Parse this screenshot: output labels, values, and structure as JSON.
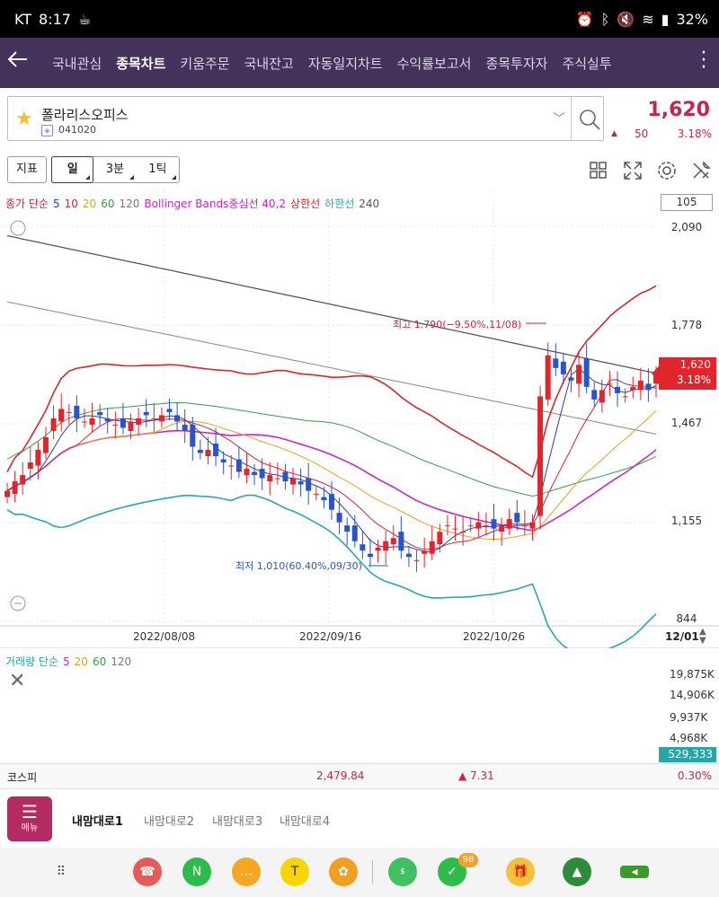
{
  "status": {
    "carrier": "KT",
    "time": "8:17",
    "battery": "32%"
  },
  "nav": {
    "tabs": [
      {
        "label": "국내관심",
        "active": false,
        "dot": false
      },
      {
        "label": "종목차트",
        "active": true,
        "dot": true
      },
      {
        "label": "키움주문",
        "active": false,
        "dot": true
      },
      {
        "label": "국내잔고",
        "active": false,
        "dot": true
      },
      {
        "label": "자동일지차트",
        "active": false,
        "dot": false
      },
      {
        "label": "수익률보고서",
        "active": false,
        "dot": false
      },
      {
        "label": "종목투자자",
        "active": false,
        "dot": false
      },
      {
        "label": "주식실투",
        "active": false,
        "dot": false
      }
    ]
  },
  "stock": {
    "name": "폴라리스오피스",
    "code": "041020",
    "price": "1,620",
    "change_arrow": "▲",
    "change": "50",
    "change_pct": "3.18%"
  },
  "toolbar": {
    "indicator_label": "지표",
    "periods": [
      {
        "label": "일",
        "active": true
      },
      {
        "label": "3분",
        "active": false
      },
      {
        "label": "1틱",
        "active": false
      }
    ]
  },
  "legend": {
    "items": [
      {
        "text": "종가 단순",
        "color": "#c8234a"
      },
      {
        "text": "5",
        "color": "#2d3ea6"
      },
      {
        "text": "10",
        "color": "#c8234a"
      },
      {
        "text": "20",
        "color": "#e0a420"
      },
      {
        "text": "60",
        "color": "#3a9a4a"
      },
      {
        "text": "120",
        "color": "#777777"
      },
      {
        "text": "Bollinger Bands중심선 40,2",
        "color": "#c42ac4"
      },
      {
        "text": "상한선",
        "color": "#d22a2a"
      },
      {
        "text": "하한선",
        "color": "#2aa5b5"
      },
      {
        "text": "240",
        "color": "#555555"
      }
    ]
  },
  "chart": {
    "y_box": "105",
    "y_labels": [
      "2,090",
      "1,778",
      "1,467",
      "1,155",
      "844"
    ],
    "price_tag": "1,620",
    "price_tag_pct": "3.18%",
    "high_annotation": "최고 1,790(−9.50%,11/08)",
    "low_annotation": "최저 1,010(60.40%,09/30)",
    "x_labels": [
      "2022/08/08",
      "2022/09/16",
      "2022/10/26"
    ],
    "last_date": "12/01"
  },
  "volume": {
    "legend": [
      {
        "text": "거래량 단순",
        "color": "#2aa5a5"
      },
      {
        "text": "5",
        "color": "#c42ac4"
      },
      {
        "text": "20",
        "color": "#e0a420"
      },
      {
        "text": "60",
        "color": "#3a9a4a"
      },
      {
        "text": "120",
        "color": "#777777"
      }
    ],
    "y_labels": [
      "19,875K",
      "14,906K",
      "9,937K",
      "4,968K"
    ],
    "tag": "529,333"
  },
  "chart_data": {
    "type": "candlestick",
    "x_labels": [
      "2022/08/08",
      "2022/09/16",
      "2022/10/26",
      "12/01"
    ],
    "y_ticks": [
      2090,
      1778,
      1467,
      1155,
      844
    ],
    "last_close": 1620,
    "high": {
      "value": 1790,
      "date": "11/08"
    },
    "low": {
      "value": 1010,
      "date": "09/30"
    },
    "candles_close": [
      1250,
      1280,
      1300,
      1340,
      1380,
      1420,
      1480,
      1510,
      1500,
      1480,
      1470,
      1480,
      1490,
      1470,
      1460,
      1450,
      1470,
      1480,
      1490,
      1480,
      1490,
      1500,
      1470,
      1440,
      1390,
      1370,
      1380,
      1360,
      1340,
      1330,
      1310,
      1320,
      1300,
      1290,
      1300,
      1290,
      1280,
      1290,
      1270,
      1250,
      1240,
      1220,
      1190,
      1150,
      1120,
      1090,
      1060,
      1040,
      1070,
      1090,
      1100,
      1060,
      1040,
      1030,
      1060,
      1090,
      1120,
      1140,
      1130,
      1120,
      1140,
      1150,
      1140,
      1130,
      1140,
      1160,
      1150,
      1140,
      1150,
      1550,
      1680,
      1640,
      1620,
      1600,
      1650,
      1580,
      1540,
      1570,
      1590,
      1560,
      1550,
      1580,
      1600,
      1570,
      1620
    ]
  }
}
